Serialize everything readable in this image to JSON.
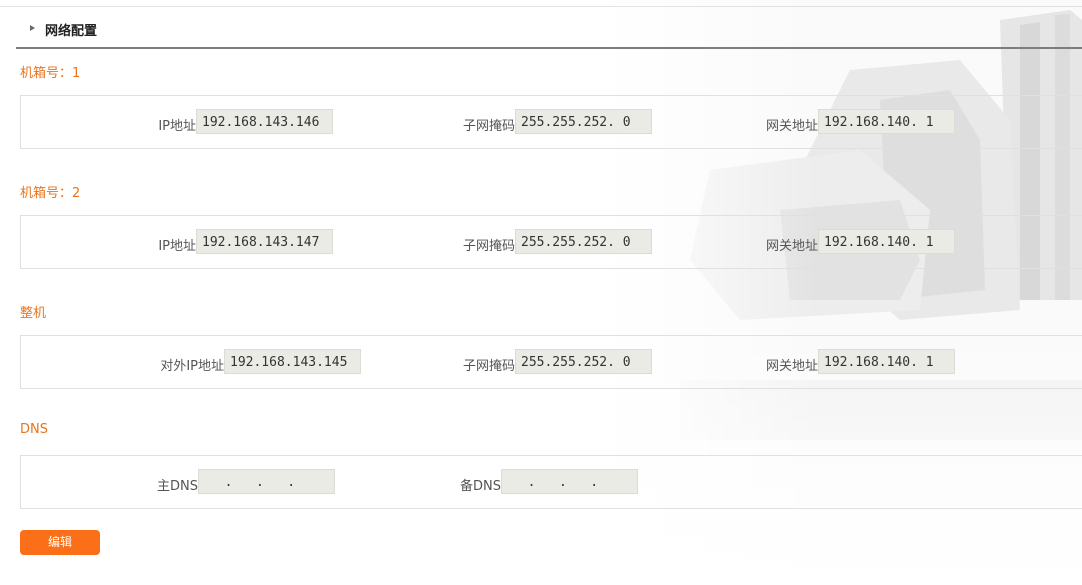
{
  "header": {
    "title": "网络配置"
  },
  "sections": [
    {
      "label": "机箱号：1",
      "ip_label": "IP地址：",
      "ip_value": "192.168.143.146",
      "mask_label": "子网掩码：",
      "mask_value": "255.255.252. 0",
      "gw_label": "网关地址：",
      "gw_value": "192.168.140. 1"
    },
    {
      "label": "机箱号：2",
      "ip_label": "IP地址：",
      "ip_value": "192.168.143.147",
      "mask_label": "子网掩码：",
      "mask_value": "255.255.252. 0",
      "gw_label": "网关地址：",
      "gw_value": "192.168.140. 1"
    },
    {
      "label": "整机",
      "ip_label": "对外IP地址：",
      "ip_value": "192.168.143.145",
      "mask_label": "子网掩码：",
      "mask_value": "255.255.252. 0",
      "gw_label": "网关地址：",
      "gw_value": "192.168.140. 1"
    }
  ],
  "dns": {
    "label": "DNS",
    "primary_label": "主DNS：",
    "primary_value": "  .   .   .",
    "secondary_label": "备DNS：",
    "secondary_value": "  .   .   ."
  },
  "edit_button": {
    "label": "编辑"
  }
}
